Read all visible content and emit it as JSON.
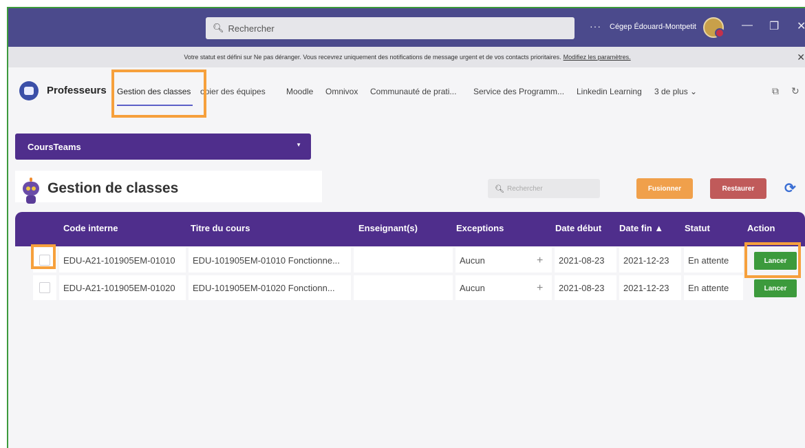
{
  "titlebar": {
    "search_placeholder": "Rechercher",
    "more_label": "···",
    "org_name": "Cégep Édouard-Montpetit",
    "minimize": "—",
    "restore": "❐",
    "close": "✕"
  },
  "notification": {
    "text": "Votre statut est défini sur Ne pas déranger. Vous recevrez uniquement des notifications de message urgent et de vos contacts prioritaires.",
    "link": "Modifiez les paramètres.",
    "close": "✕"
  },
  "team": {
    "name": "Professeurs",
    "tabs": [
      {
        "label": "Gestion des classes"
      },
      {
        "label": "opier des équipes"
      },
      {
        "label": "Moodle"
      },
      {
        "label": "Omnivox"
      },
      {
        "label": "Communauté de prati..."
      },
      {
        "label": "Service des Programm..."
      },
      {
        "label": "Linkedin Learning"
      },
      {
        "label": "3 de plus ⌄"
      }
    ]
  },
  "dropdown": {
    "label": "CoursTeams",
    "caret": "▼"
  },
  "panel": {
    "title": "Gestion de classes",
    "search_placeholder": "Rechercher",
    "merge_label": "Fusionner",
    "restore_label": "Restaurer",
    "refresh_icon": "⟳"
  },
  "table": {
    "headers": {
      "code": "Code interne",
      "title": "Titre du cours",
      "teachers": "Enseignant(s)",
      "exceptions": "Exceptions",
      "start": "Date début",
      "end": "Date fin ▲",
      "status": "Statut",
      "action": "Action"
    },
    "rows": [
      {
        "code": "EDU-A21-101905EM-01010",
        "title": "EDU-101905EM-01010 Fonctionne...",
        "teachers": "",
        "exceptions": "Aucun",
        "plus": "+",
        "start": "2021-08-23",
        "end": "2021-12-23",
        "status": "En attente",
        "action": "Lancer"
      },
      {
        "code": "EDU-A21-101905EM-01020",
        "title": "EDU-101905EM-01020 Fonctionn...",
        "teachers": "",
        "exceptions": "Aucun",
        "plus": "+",
        "start": "2021-08-23",
        "end": "2021-12-23",
        "status": "En attente",
        "action": "Lancer"
      }
    ]
  },
  "colors": {
    "titlebar": "#4b4a8c",
    "purple": "#4f2e8c",
    "highlight": "#f6a03c",
    "launch": "#3c9a3c",
    "merge": "#f0a04b",
    "restore": "#c05a5a"
  }
}
